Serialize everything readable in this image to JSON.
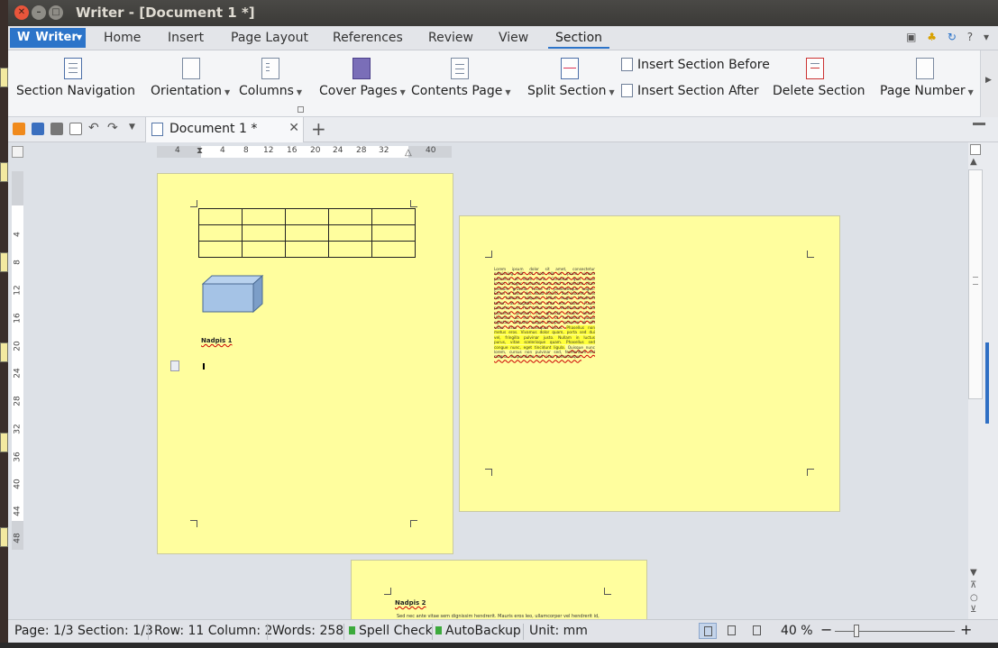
{
  "window": {
    "title": "Writer - [Document 1 *]"
  },
  "menu": {
    "app_label": "Writer",
    "items": [
      "Home",
      "Insert",
      "Page Layout",
      "References",
      "Review",
      "View",
      "Section"
    ],
    "active": "Section",
    "help_label": "?"
  },
  "ribbon": {
    "section_navigation": "Section Navigation",
    "orientation": "Orientation",
    "columns": "Columns",
    "cover_pages": "Cover Pages",
    "contents_page": "Contents Page",
    "split_section": "Split Section",
    "insert_section_before": "Insert Section Before",
    "insert_section_after": "Insert Section After",
    "delete_section": "Delete Section",
    "page_number": "Page Number"
  },
  "doc_tabs": [
    {
      "name": "Document 1 *"
    }
  ],
  "ruler": {
    "horizontal": [
      "4",
      "4",
      "8",
      "12",
      "16",
      "20",
      "24",
      "28",
      "32",
      "40"
    ],
    "vertical": [
      "4",
      "8",
      "12",
      "16",
      "20",
      "24",
      "28",
      "32",
      "36",
      "40",
      "44",
      "48"
    ]
  },
  "document": {
    "page1_heading": "Nadpis 1",
    "page3_heading": "Nadpis 2",
    "lorem_a": "Lorem ipsum dolor sit amet, consectetur adipiscing elit. Ut sed elit in ipsum viverra pharetra at vitae nunc. Curabitur quis lacus lorem. Integer molestie nunc sed a molestie vitae pretium gravida. Fusce et pellentesque augue. Etiam in tellus dui. Nulla facilisi. Sed laoreet, felis non lobortis aliquam, tellus augue hendrerit tortor, at sagittis nisi ante non dolor. Fusce posuere nunc non tellus metus. Vestibulum id dui pharetra, pretium dui gravida, ornare lorem. Vivamus ac est tristique, ut hendrerit purus egestas. Aliquam augue tempor posuere at elit vitae. Cras sit consequat lacus.",
    "lorem_hl": "Phasellus non metus eros. Vivamus dolor quam, porta sed dui vel, fringilla pulvinar justo. Nullam in luctus purus, vitae scelerisque quam. Phasellus sed congue nunc, eget tincidunt ligula.",
    "lorem_b": "Quisque nunc lorem, cursus non pulvinar sed, fermentum vel magna. Suspendisse sed risus pellentesque.",
    "page3_text": "Sed nec ante vitae sem dignissim hendrerit. Mauris eros leo, ullamcorper vel hendrerit id,"
  },
  "status": {
    "page": "Page: 1/3 Section: 1/3",
    "row_col": "Row: 11 Column: 2",
    "words": "Words: 258",
    "spell_check": "Spell Check",
    "autobackup": "AutoBackup",
    "unit": "Unit: mm",
    "zoom": "40 %",
    "zoom_minus": "−",
    "zoom_plus": "+"
  },
  "colors": {
    "accent": "#2c74c9",
    "page_bg": "#fffe9e",
    "status_ok": "#3caa3c"
  },
  "icons": [
    "close-icon",
    "minimize-icon",
    "maximize-icon",
    "save-icon",
    "print-icon",
    "undo-icon",
    "redo-icon"
  ]
}
